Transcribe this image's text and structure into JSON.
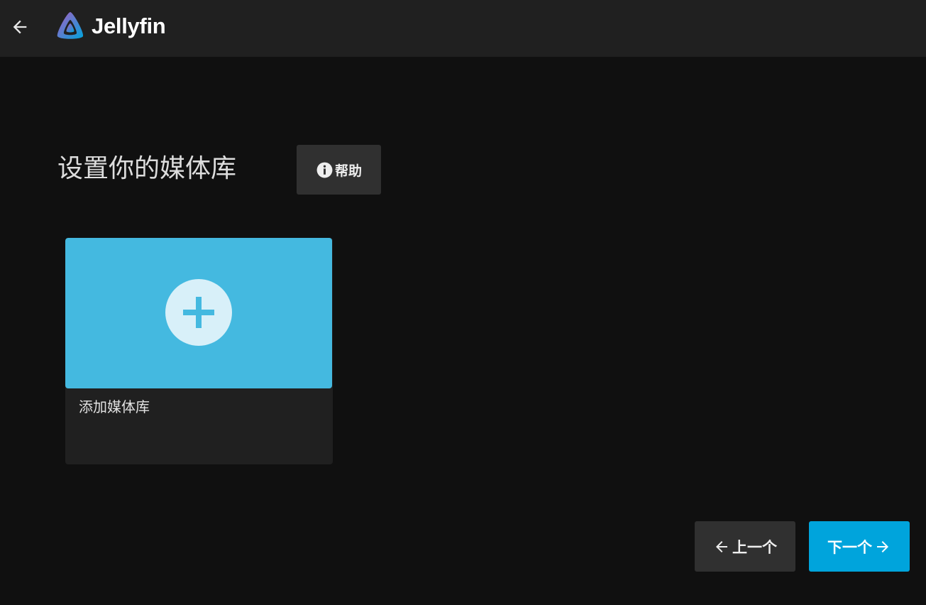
{
  "header": {
    "back_icon": "arrow-left-icon",
    "logo_icon": "jellyfin-logo-icon",
    "logo_text": "Jellyfin"
  },
  "main": {
    "title": "设置你的媒体库",
    "help_button": {
      "icon": "info-icon",
      "label": "帮助"
    },
    "library_card": {
      "icon": "plus-circle-icon",
      "label": "添加媒体库"
    }
  },
  "footer": {
    "prev_button": {
      "icon": "arrow-left-icon",
      "label": "上一个"
    },
    "next_button": {
      "icon": "arrow-right-icon",
      "label": "下一个"
    }
  },
  "colors": {
    "background": "#101010",
    "header_background": "#202020",
    "card_image": "#44b9e0",
    "accent_button": "#00a4dc",
    "secondary_button": "#303030"
  }
}
